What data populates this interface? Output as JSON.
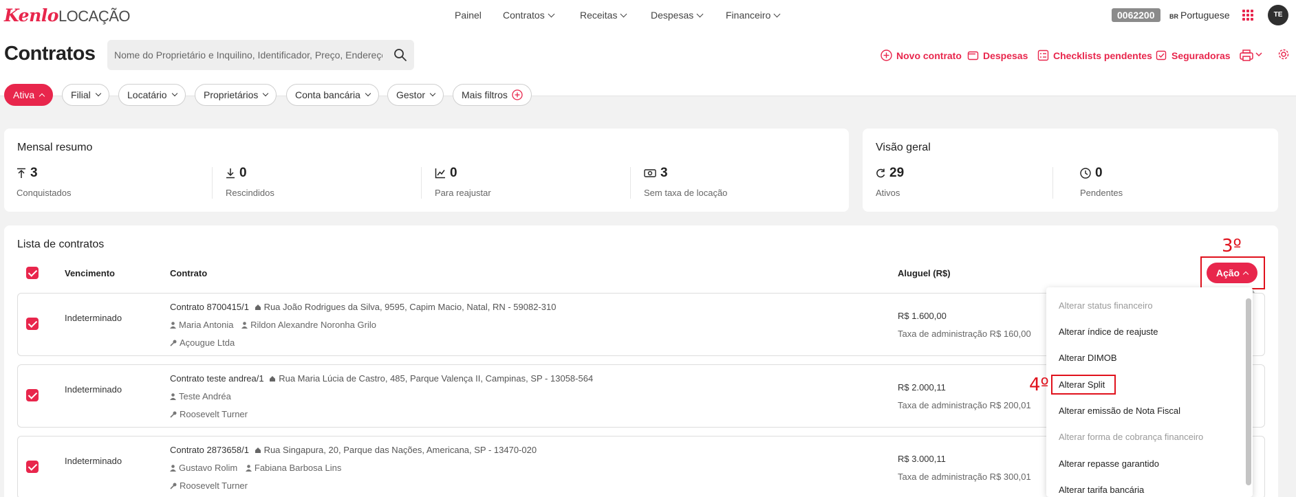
{
  "brand": {
    "logo_kenlo": "Kenlo",
    "logo_product": "LOCAÇÃO"
  },
  "nav": {
    "items": [
      {
        "label": "Painel"
      },
      {
        "label": "Contratos"
      },
      {
        "label": "Receitas"
      },
      {
        "label": "Despesas"
      },
      {
        "label": "Financeiro"
      }
    ]
  },
  "topbar": {
    "code": "0062200",
    "lang_flag": "BR",
    "lang_label": "Portuguese",
    "avatar": "TE"
  },
  "header": {
    "title": "Contratos",
    "search_placeholder": "Nome do Proprietário e Inquilino, Identificador, Preço, Endereço...",
    "actions": [
      {
        "label": "Novo contrato",
        "icon": "plus-circle-icon"
      },
      {
        "label": "Despesas",
        "icon": "wallet-icon"
      },
      {
        "label": "Checklists pendentes",
        "icon": "checklist-icon"
      },
      {
        "label": "Seguradoras",
        "icon": "insurance-icon"
      }
    ]
  },
  "filters": [
    "Ativa",
    "Filial",
    "Locatário",
    "Proprietários",
    "Conta bancária",
    "Gestor",
    "Mais filtros"
  ],
  "monthly": {
    "title": "Mensal resumo",
    "metrics": [
      {
        "value": "3",
        "label": "Conquistados"
      },
      {
        "value": "0",
        "label": "Rescindidos"
      },
      {
        "value": "0",
        "label": "Para reajustar"
      },
      {
        "value": "3",
        "label": "Sem taxa de locação"
      }
    ]
  },
  "overview": {
    "title": "Visão geral",
    "metrics": [
      {
        "value": "29",
        "label": "Ativos"
      },
      {
        "value": "0",
        "label": "Pendentes"
      }
    ]
  },
  "list": {
    "title": "Lista de contratos",
    "columns": {
      "due": "Vencimento",
      "contract": "Contrato",
      "rent": "Aluguel (R$)"
    },
    "action_button": "Ação",
    "rows": [
      {
        "due": "Indeterminado",
        "contract": "Contrato 8700415/1",
        "address": "Rua João Rodrigues da Silva, 9595, Capim Macio, Natal, RN - 59082-310",
        "people": [
          "Maria Antonia",
          "Rildon Alexandre Noronha Grilo"
        ],
        "owner": "Açougue Ltda",
        "rent": "R$ 1.600,00",
        "fee": "Taxa de administração R$ 160,00"
      },
      {
        "due": "Indeterminado",
        "contract": "Contrato teste andrea/1",
        "address": "Rua Maria Lúcia de Castro, 485, Parque Valença II, Campinas, SP - 13058-564",
        "people": [
          "Teste Andréa"
        ],
        "owner": "Roosevelt Turner",
        "rent": "R$ 2.000,11",
        "fee": "Taxa de administração R$ 200,01"
      },
      {
        "due": "Indeterminado",
        "contract": "Contrato 2873658/1",
        "address": "Rua Singapura, 20, Parque das Nações, Americana, SP - 13470-020",
        "people": [
          "Gustavo Rolim",
          "Fabiana Barbosa Lins"
        ],
        "owner": "Roosevelt Turner",
        "rent": "R$ 3.000,11",
        "fee": "Taxa de administração R$ 300,01"
      }
    ]
  },
  "dropdown": {
    "items": [
      {
        "label": "Alterar status financeiro",
        "disabled": true
      },
      {
        "label": "Alterar índice de reajuste",
        "disabled": false
      },
      {
        "label": "Alterar DIMOB",
        "disabled": false
      },
      {
        "label": "Alterar Split",
        "disabled": false
      },
      {
        "label": "Alterar emissão de Nota Fiscal",
        "disabled": false
      },
      {
        "label": "Alterar forma de cobrança financeiro",
        "disabled": true
      },
      {
        "label": "Alterar repasse garantido",
        "disabled": false
      },
      {
        "label": "Alterar tarifa bancária",
        "disabled": false
      }
    ]
  },
  "annotations": {
    "step3": "3º",
    "step4": "4º"
  },
  "colors": {
    "accent": "#e8264c",
    "annotation": "#e0111c"
  }
}
